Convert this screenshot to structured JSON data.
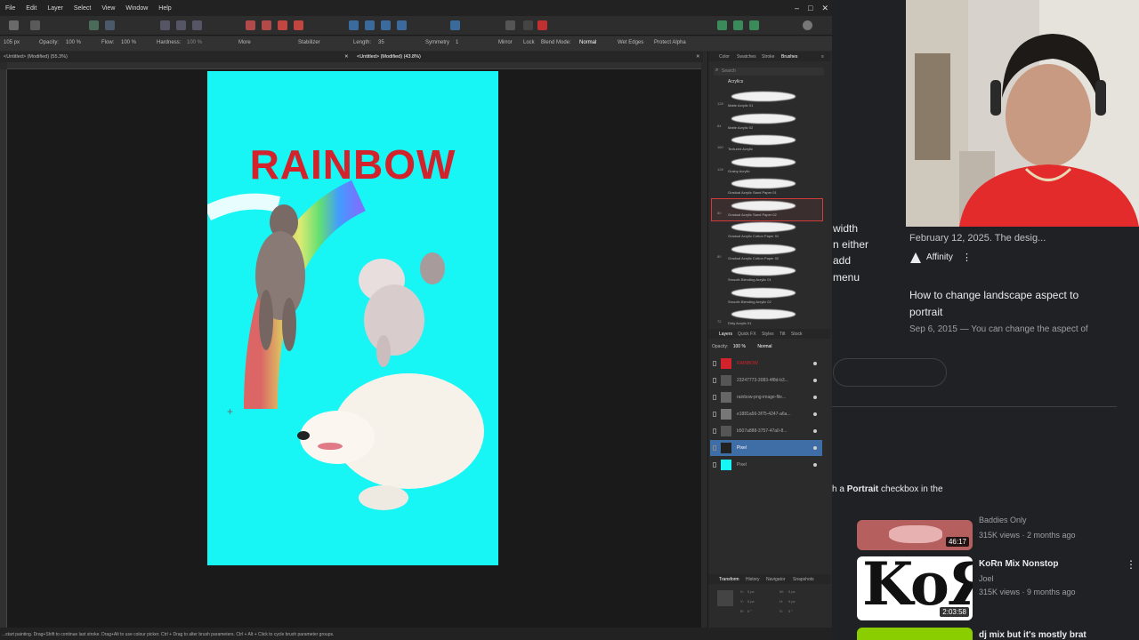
{
  "app": {
    "menus": [
      "File",
      "Edit",
      "Layer",
      "Select",
      "View",
      "Window",
      "Help"
    ],
    "window_controls": [
      "–",
      "□",
      "✕"
    ],
    "context_toolbar": {
      "width": "105 px",
      "opacity_label": "Opacity:",
      "opacity_value": "100 %",
      "flow_label": "Flow:",
      "flow_value": "100 %",
      "hardness_label": "Hardness:",
      "hardness_value": "100 %",
      "more": "More",
      "stabilizer": "Stabilizer",
      "length_label": "Length:",
      "length_value": "35",
      "symmetry_label": "Symmetry",
      "symmetry_value": "1",
      "mirror": "Mirror",
      "lock": "Lock",
      "blend_mode_label": "Blend Mode:",
      "blend_mode_value": "Normal",
      "wet_edges": "Wet Edges",
      "protect_alpha": "Protect Alpha"
    },
    "doc_tabs": [
      "<Untitled> (Modified) (55.3%)",
      "<Untitled> (Modified) (43.8%)"
    ],
    "canvas": {
      "title_text": "RAINBOW",
      "background_color": "#17f5f5",
      "title_color": "#d2232c"
    },
    "status_text": "...start painting. Drag+Shift to continue last stroke. Drag+Alt to use colour picker. Ctrl + Drag to alter brush parameters. Ctrl + Alt + Click to cycle brush parameter groups."
  },
  "studio": {
    "top_tabs": [
      "Color",
      "Swatches",
      "Stroke",
      "Brushes"
    ],
    "active_top_tab": "Brushes",
    "search_placeholder": "Search",
    "brush_category": "Acrylics",
    "brushes": [
      {
        "size": "128",
        "name": "Matte Acrylic 01"
      },
      {
        "size": "84",
        "name": "Matte Acrylic 02"
      },
      {
        "size": "160",
        "name": "Textured Acrylic"
      },
      {
        "size": "128",
        "name": "Grainy Acrylic"
      },
      {
        "size": "",
        "name": "Gradual Acrylic Sand Paper 01"
      },
      {
        "size": "80",
        "name": "Gradual Acrylic Sand Paper 02"
      },
      {
        "size": "",
        "name": "Gradual Acrylic Cotton Paper 01"
      },
      {
        "size": "80",
        "name": "Gradual Acrylic Cotton Paper 02"
      },
      {
        "size": "",
        "name": "Smooth Blending Acrylic 01"
      },
      {
        "size": "",
        "name": "Smooth Blending Acrylic 02"
      },
      {
        "size": "72",
        "name": "Dirty Acrylic 01"
      }
    ],
    "layer_tabs": [
      "Layers",
      "Quick FX",
      "Styles",
      "Tilt",
      "Stock"
    ],
    "layer_opacity_label": "Opacity:",
    "layer_opacity_value": "100 %",
    "layer_blend_value": "Normal",
    "layers": [
      {
        "name": "RAINBOW",
        "thumb": "#d2232c"
      },
      {
        "name": "23247773-3083-4f8d-b3...",
        "thumb": "#555"
      },
      {
        "name": "rainbow-png-image-file...",
        "thumb": "#666"
      },
      {
        "name": "e1881a56-3f75-4247-a6a...",
        "thumb": "#777"
      },
      {
        "name": "b507a888-3757-47a0-8...",
        "thumb": "#555"
      },
      {
        "name": "Pixel",
        "thumb": "#222"
      },
      {
        "name": "Pixel",
        "thumb": "#17f5f5"
      }
    ],
    "bottom_tabs": [
      "Transform",
      "History",
      "Navigator",
      "Snapshots"
    ],
    "transform_fields": [
      "X:",
      "Y:",
      "W:",
      "H:",
      "R:",
      "S:"
    ],
    "transform_values": [
      "0 px",
      "0 px",
      "0 px",
      "0 px",
      "0 °",
      "0 °"
    ]
  },
  "browser": {
    "partial_left_text": [
      "width",
      "n either",
      "add",
      "menu"
    ],
    "result_date_snippet": "February 12, 2025. The desig...",
    "result_source": "Affinity",
    "result_title_line1": "How to change landscape aspect to",
    "result_title_line2": "portrait",
    "result_snippet": "Sep 6, 2015 — You can change the aspect of",
    "answer_prefix": "h a ",
    "answer_bold": "Portrait",
    "answer_suffix": " checkbox in the",
    "videos": [
      {
        "title": "Baddies Only",
        "stats": "315K views · 2 months ago",
        "duration": "46:17"
      },
      {
        "title": "KoRn Mix Nonstop",
        "channel": "Joel",
        "stats": "315K views · 9 months ago",
        "duration": "2:03:58"
      },
      {
        "title": "dj mix but it's mostly brat"
      }
    ]
  }
}
